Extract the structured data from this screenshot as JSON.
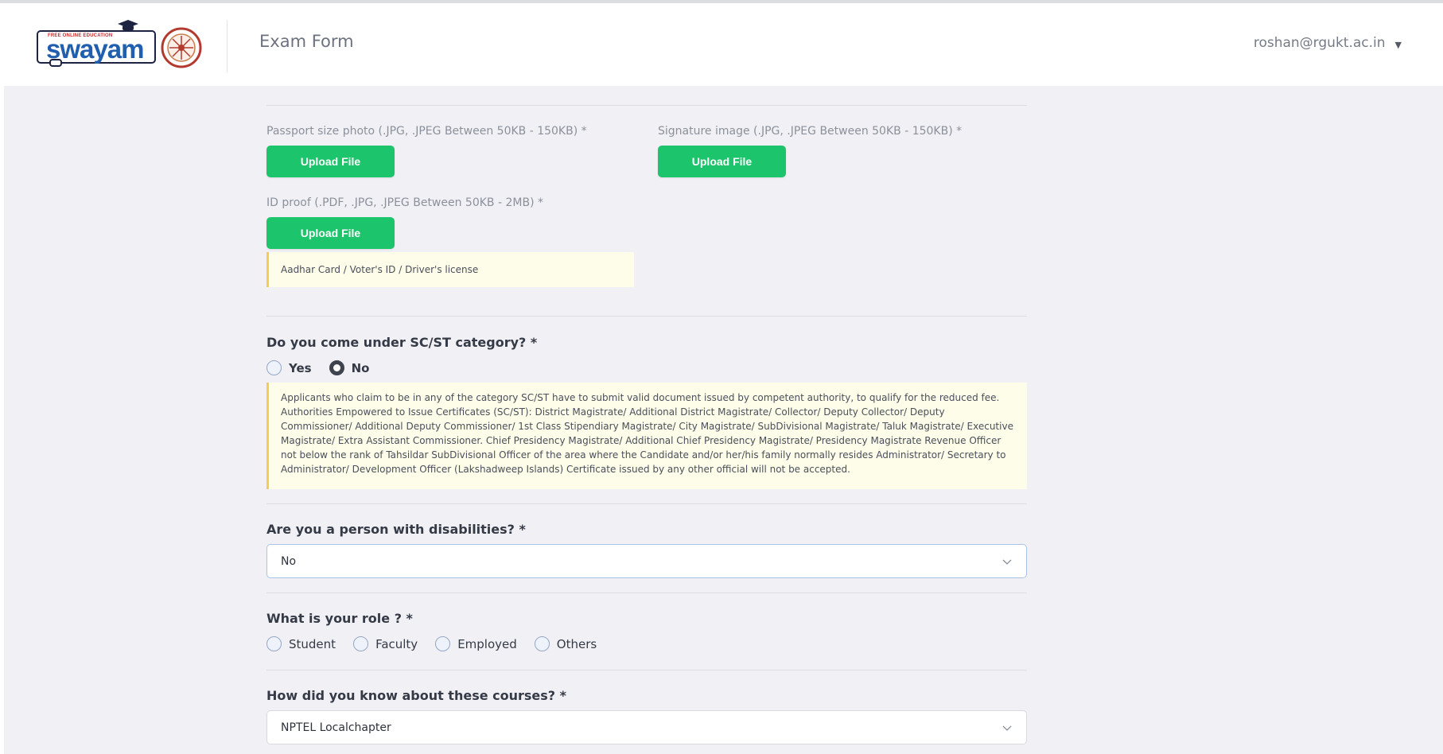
{
  "header": {
    "logo": {
      "tagline": "FREE ONLINE EDUCATION",
      "wordmark": "swayam"
    },
    "title": "Exam Form",
    "user_email": "roshan@rgukt.ac.in",
    "user_caret": "▼"
  },
  "uploads": {
    "photo": {
      "label": "Passport size photo (.JPG, .JPEG Between 50KB - 150KB) *",
      "button": "Upload File"
    },
    "signature": {
      "label": "Signature image (.JPG, .JPEG Between 50KB - 150KB) *",
      "button": "Upload File"
    },
    "id_proof": {
      "label": "ID proof (.PDF, .JPG, .JPEG Between 50KB - 2MB) *",
      "button": "Upload File",
      "note": "Aadhar Card / Voter's ID / Driver's license"
    }
  },
  "scst": {
    "question": "Do you come under SC/ST category? *",
    "options": [
      {
        "label": "Yes",
        "checked": false
      },
      {
        "label": "No",
        "checked": true
      }
    ],
    "note": "Applicants who claim to be in any of the category SC/ST have to submit valid document issued by competent authority, to qualify for the reduced fee. Authorities Empowered to Issue Certificates (SC/ST): District Magistrate/ Additional District Magistrate/ Collector/ Deputy Collector/ Deputy Commissioner/ Additional Deputy Commissioner/ 1st Class Stipendiary Magistrate/ City Magistrate/ SubDivisional Magistrate/ Taluk Magistrate/ Executive Magistrate/ Extra Assistant Commissioner. Chief Presidency Magistrate/ Additional Chief Presidency Magistrate/ Presidency Magistrate Revenue Officer not below the rank of Tahsildar SubDivisional Officer of the area where the Candidate and/or her/his family normally resides Administrator/ Secretary to Administrator/ Development Officer (Lakshadweep Islands) Certificate issued by any other official will not be accepted."
  },
  "disability": {
    "question": "Are you a person with disabilities? *",
    "selected": "No"
  },
  "role": {
    "question": "What is your role ? *",
    "options": [
      {
        "label": "Student",
        "checked": false
      },
      {
        "label": "Faculty",
        "checked": false
      },
      {
        "label": "Employed",
        "checked": false
      },
      {
        "label": "Others",
        "checked": false
      }
    ]
  },
  "source": {
    "question": "How did you know about these courses? *",
    "selected": "NPTEL Localchapter"
  },
  "colors": {
    "accent_green": "#1cc46c",
    "note_background": "#fefde9",
    "note_border": "#f4cd52",
    "page_background": "#f1f1f5"
  }
}
